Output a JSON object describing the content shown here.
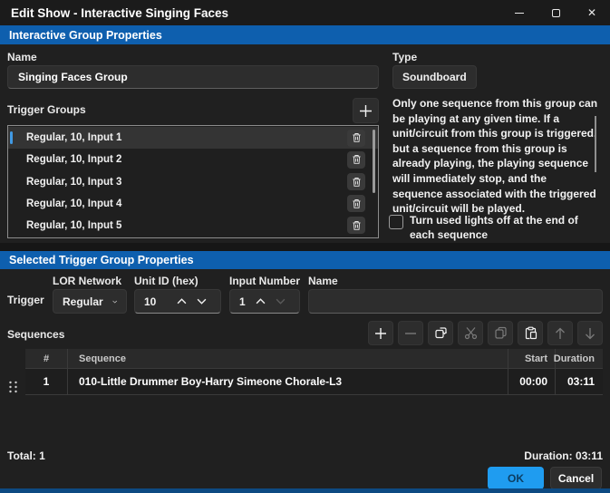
{
  "window": {
    "title": "Edit Show - Interactive Singing Faces",
    "close_glyph": "✕"
  },
  "colors": {
    "section_header_blue": "#0e5fae",
    "ok_button_blue": "#1f9cf0",
    "selected_row_accent": "#4199e3"
  },
  "group_properties": {
    "header": "Interactive Group Properties",
    "name_label": "Name",
    "name_value": "Singing Faces Group",
    "type_label": "Type",
    "type_value": "Soundboard",
    "trigger_groups_label": "Trigger Groups",
    "trigger_groups": [
      {
        "label": "Regular, 10, Input 1",
        "selected": true
      },
      {
        "label": "Regular, 10, Input 2",
        "selected": false
      },
      {
        "label": "Regular, 10, Input 3",
        "selected": false
      },
      {
        "label": "Regular, 10, Input 4",
        "selected": false
      },
      {
        "label": "Regular, 10, Input 5",
        "selected": false
      }
    ],
    "info_text": "Only one sequence from this group can be playing at any given time. If a unit/circuit from this group is triggered, but a sequence from this group is already playing, the playing sequence will immediately stop, and the sequence associated with the triggered unit/circuit will be played.",
    "lights_off_label": "Turn used lights off at the end of each sequence",
    "lights_off_checked": false
  },
  "selected_trigger": {
    "header": "Selected Trigger Group Properties",
    "trigger_label": "Trigger",
    "lor_network_label": "LOR Network",
    "lor_network_value": "Regular",
    "unit_id_label": "Unit ID (hex)",
    "unit_id_value": "10",
    "input_number_label": "Input Number",
    "input_number_value": "1",
    "name_label": "Name",
    "name_value": ""
  },
  "sequences": {
    "label": "Sequences",
    "columns": {
      "num": "#",
      "sequence": "Sequence",
      "start": "Start",
      "duration": "Duration"
    },
    "rows": [
      {
        "num": "1",
        "sequence": "010-Little Drummer Boy-Harry Simeone Chorale-L3",
        "start": "00:00",
        "duration": "03:11"
      }
    ],
    "total_label": "Total: 1",
    "duration_label": "Duration: 03:11"
  },
  "footer": {
    "ok": "OK",
    "cancel": "Cancel"
  }
}
